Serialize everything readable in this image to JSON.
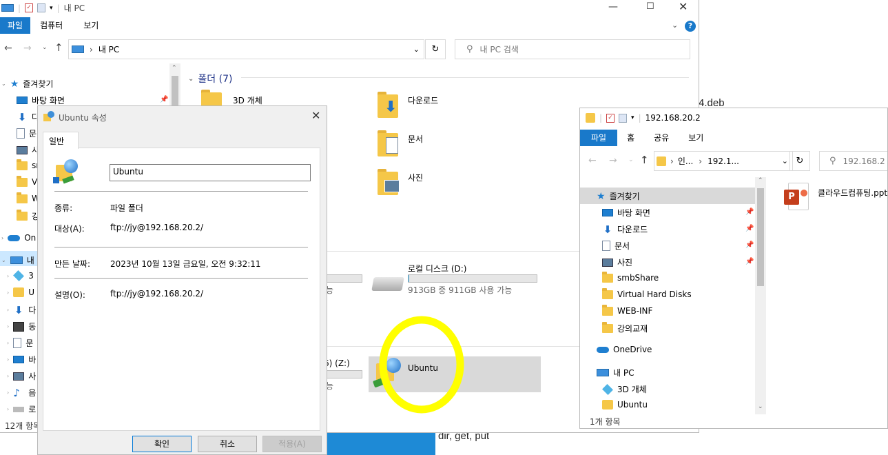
{
  "background": {
    "doc_text_1": "4.deb",
    "doc_text_2": "dir, get, put"
  },
  "main_window": {
    "title": "내 PC",
    "ribbon_tabs": [
      "파일",
      "컴퓨터",
      "보기"
    ],
    "address_path": "내 PC",
    "search_placeholder": "내 PC 검색",
    "folders_header": "폴더 (7)",
    "folders": [
      {
        "label": "3D 개체"
      },
      {
        "label": "다운로드"
      },
      {
        "label": "문서"
      },
      {
        "label": "사진"
      }
    ],
    "drive_d": {
      "label": "로컬 디스크 (D:)",
      "free": "913GB 중 911GB 사용 가능",
      "used_fraction": 0.002
    },
    "drive_left_partial_1": "능",
    "drive_left_partial_2": "6) (Z:)",
    "drive_left_partial_3": "능",
    "network_item": {
      "label": "Ubuntu"
    },
    "status_text": "12개 항목",
    "nav": {
      "quick_access": "즐겨찾기",
      "items": [
        "바탕 화면",
        "다",
        "문",
        "사",
        "sr",
        "V",
        "W",
        "강"
      ],
      "onedrive": "On",
      "this_pc": "내",
      "pc_items": [
        "3",
        "U",
        "다",
        "동",
        "문",
        "바",
        "사",
        "음",
        "로"
      ]
    }
  },
  "properties_dialog": {
    "title": "Ubuntu 속성",
    "tab": "일반",
    "name_value": "Ubuntu",
    "rows": [
      {
        "label": "종류:",
        "value": "파일 폴더"
      },
      {
        "label": "대상(A):",
        "value": "ftp://jy@192.168.20.2/"
      },
      {
        "label": "만든 날짜:",
        "value": "2023년 10월 13일 금요일, 오전 9:32:11"
      },
      {
        "label": "설명(O):",
        "value": "ftp://jy@192.168.20.2/"
      }
    ],
    "buttons": {
      "ok": "확인",
      "cancel": "취소",
      "apply": "적용(A)"
    }
  },
  "ftp_window": {
    "title": "192.168.20.2",
    "ribbon_tabs": [
      "파일",
      "홈",
      "공유",
      "보기"
    ],
    "address_parts": [
      "인...",
      "192.1..."
    ],
    "search_placeholder": "192.168.2",
    "nav": {
      "quick_access": "즐겨찾기",
      "items": [
        "바탕 화면",
        "다운로드",
        "문서",
        "사진",
        "smbShare",
        "Virtual Hard Disks",
        "WEB-INF",
        "강의교재"
      ],
      "onedrive": "OneDrive",
      "this_pc": "내 PC",
      "pc_items": [
        "3D 개체",
        "Ubuntu"
      ]
    },
    "file": {
      "label": "클라우드컴퓨팅.ppt"
    },
    "status_text": "1개 항목"
  },
  "colors": {
    "accent": "#1979ca",
    "highlight": "#ffff00",
    "selected": "#cce8ff"
  }
}
